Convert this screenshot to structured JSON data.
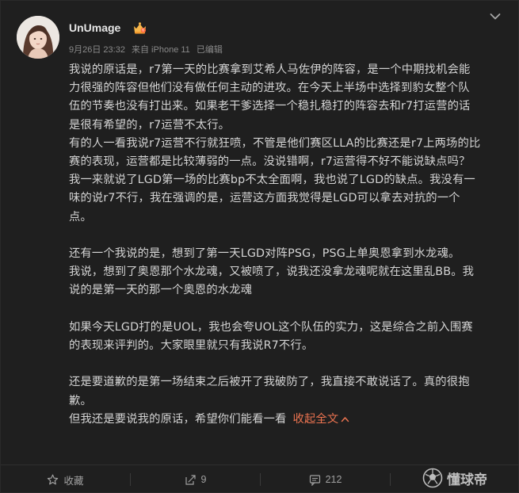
{
  "post": {
    "author": {
      "username": "UnUmage",
      "avatar_icon": "avatar-photo",
      "badge_icon": "vip-crown-icon"
    },
    "meta": {
      "time": "9月26日 23:32",
      "source": "来自 iPhone 11",
      "edited": "已编辑"
    },
    "paragraphs": [
      "我说的原话是，r7第一天的比赛拿到艾希人马佐伊的阵容，是一个中期找机会能",
      "力很强的阵容但他们没有做任何主动的进攻。在今天上半场中选择到豹女整个队",
      "伍的节奏也没有打出来。如果老干爹选择一个稳扎稳打的阵容去和r7打运营的话",
      "是很有希望的，r7运营不太行。",
      "有的人一看我说r7运营不行就狂喷，不管是他们赛区LLA的比赛还是r7上两场的比",
      "赛的表现，运营都是比较薄弱的一点。没说错啊，r7运营得不好不能说缺点吗？",
      "我一来就说了LGD第一场的比赛bp不太全面啊，我也说了LGD的缺点。我没有一",
      "味的说r7不行，我在强调的是，运营这方面我觉得是LGD可以拿去对抗的一个",
      "点。",
      "",
      "还有一个我说的是，想到了第一天LGD对阵PSG，PSG上单奥恩拿到水龙魂。",
      "我说，想到了奥恩那个水龙魂，又被喷了，说我还没拿龙魂呢就在这里乱BB。我",
      "说的是第一天的那一个奥恩的水龙魂",
      "",
      "如果今天LGD打的是UOL，我也会夸UOL这个队伍的实力，这是综合之前入围赛",
      "的表现来评判的。大家眼里就只有我说R7不行。",
      "",
      "还是要道歉的是第一场结束之后被开了我破防了，我直接不敢说话了。真的很抱",
      "歉。",
      "但我还是要说我的原话，希望你们能看一看"
    ],
    "collapse_label": "收起全文"
  },
  "footer": {
    "favorite_label": "收藏",
    "repost_count": "9",
    "comment_count": "212",
    "like_count": ""
  },
  "watermark": {
    "text": "懂球帝"
  },
  "colors": {
    "background": "#1f1f1f",
    "text": "#d4d4d4",
    "meta": "#8a8a8a",
    "accent": "#eb7350"
  }
}
